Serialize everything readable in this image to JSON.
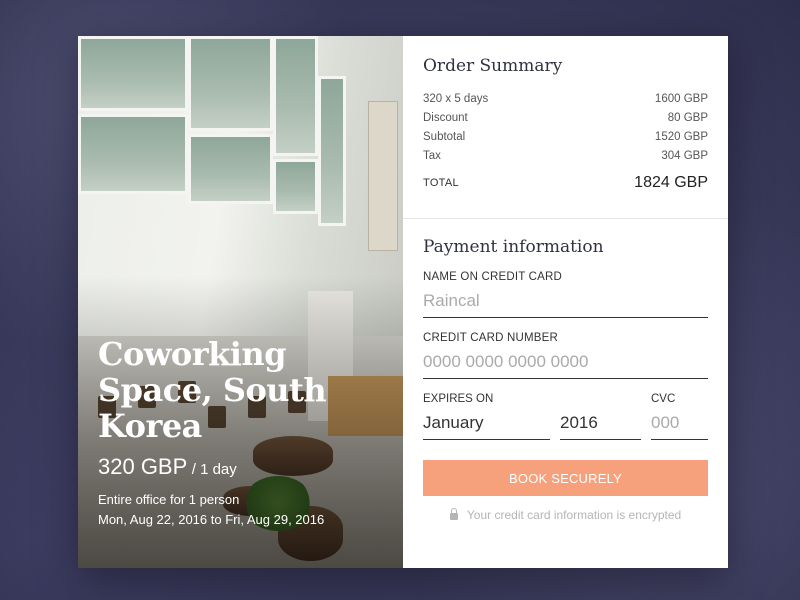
{
  "venue": {
    "title": "Coworking Space, South Korea",
    "price": "320 GBP",
    "price_unit": "/ 1 day",
    "detail_line1": "Entire office for 1 person",
    "detail_line2": "Mon, Aug 22, 2016 to Fri, Aug 29, 2016"
  },
  "order_summary": {
    "title": "Order Summary",
    "rows": [
      {
        "label": "320 x 5 days",
        "value": "1600 GBP"
      },
      {
        "label": "Discount",
        "value": "80 GBP"
      },
      {
        "label": "Subtotal",
        "value": "1520 GBP"
      },
      {
        "label": "Tax",
        "value": "304 GBP"
      }
    ],
    "total_label": "TOTAL",
    "total_value": "1824 GBP"
  },
  "payment": {
    "title": "Payment information",
    "name_label": "NAME ON CREDIT CARD",
    "name_placeholder": "Raincal",
    "card_label": "CREDIT CARD NUMBER",
    "card_placeholder": "0000 0000 0000 0000",
    "expires_label": "EXPIRES ON",
    "cvc_label": "CVC",
    "month_value": "January",
    "year_value": "2016",
    "cvc_placeholder": "000",
    "button_label": "BOOK SECURELY",
    "secure_note": "Your credit card information is encrypted"
  },
  "colors": {
    "accent": "#f7a07c",
    "background": "#3a3a5c"
  },
  "icons": {
    "secure_note": "lock-icon"
  }
}
